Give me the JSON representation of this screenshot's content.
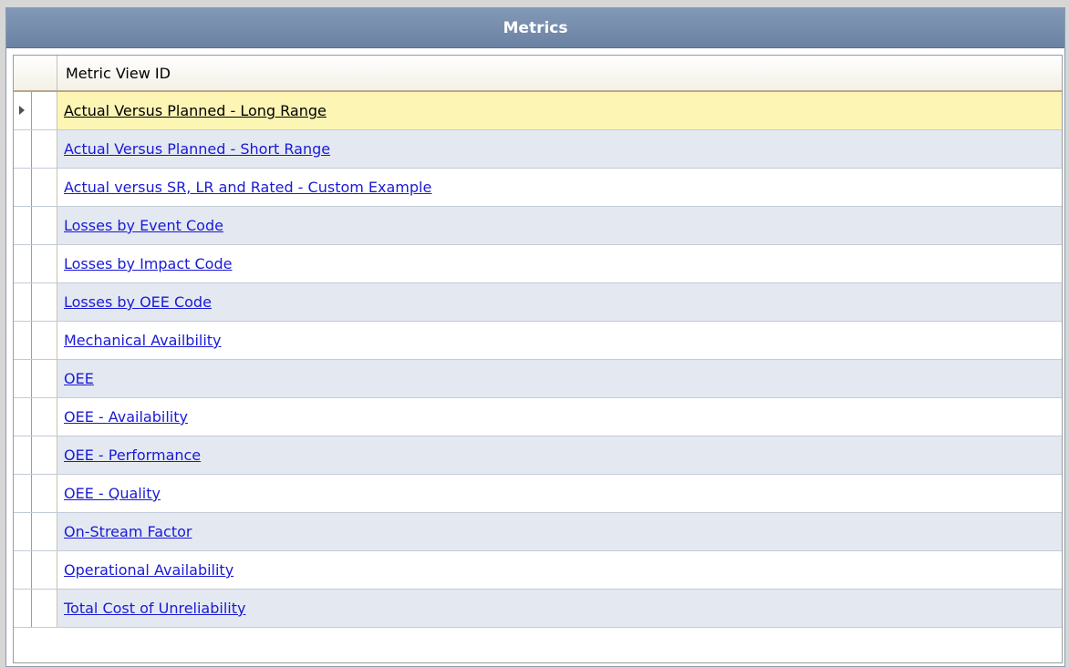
{
  "panel": {
    "title": "Metrics"
  },
  "grid": {
    "column_header": "Metric View ID",
    "selected_index": 0,
    "rows": [
      {
        "label": "Actual Versus Planned  - Long Range"
      },
      {
        "label": "Actual Versus Planned  - Short Range"
      },
      {
        "label": "Actual versus SR, LR and Rated - Custom Example"
      },
      {
        "label": "Losses by Event Code"
      },
      {
        "label": "Losses by Impact Code"
      },
      {
        "label": "Losses by OEE Code"
      },
      {
        "label": "Mechanical Availbility"
      },
      {
        "label": "OEE"
      },
      {
        "label": "OEE - Availability"
      },
      {
        "label": "OEE - Performance"
      },
      {
        "label": "OEE - Quality"
      },
      {
        "label": "On-Stream Factor"
      },
      {
        "label": "Operational Availability"
      },
      {
        "label": "Total Cost of Unreliability"
      }
    ]
  },
  "colors": {
    "header_bg": "#7288a8",
    "link": "#1a1ad6",
    "selected_row": "#fdf5b4",
    "alt_row": "#e4e9f1"
  }
}
